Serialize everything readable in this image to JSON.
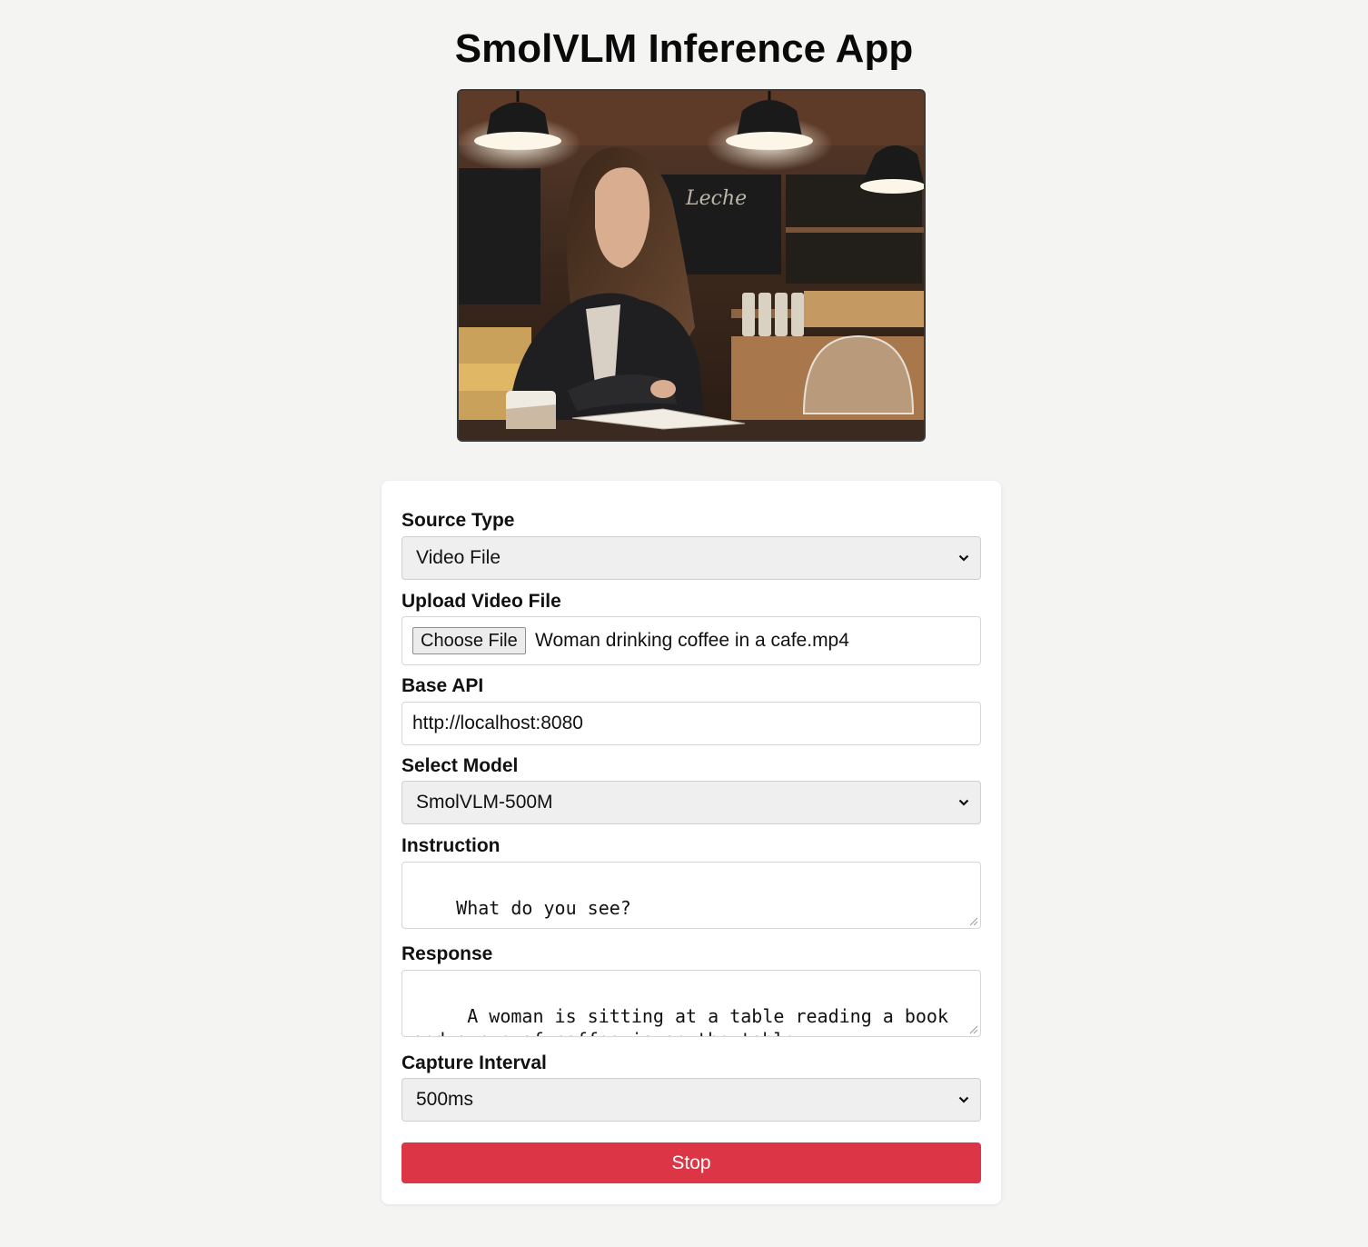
{
  "app": {
    "title": "SmolVLM Inference App"
  },
  "video": {
    "scene": "woman-reading-in-cafe"
  },
  "form": {
    "source_type": {
      "label": "Source Type",
      "selected": "Video File"
    },
    "upload": {
      "label": "Upload Video File",
      "button_label": "Choose File",
      "file_name": "Woman drinking coffee in a cafe.mp4"
    },
    "base_api": {
      "label": "Base API",
      "value": "http://localhost:8080"
    },
    "model": {
      "label": "Select Model",
      "selected": "SmolVLM-500M"
    },
    "instruction": {
      "label": "Instruction",
      "value": "What do you see?"
    },
    "response": {
      "label": "Response",
      "value": " A woman is sitting at a table reading a book and a cup of coffee is on the table."
    },
    "capture_interval": {
      "label": "Capture Interval",
      "selected": "500ms"
    },
    "action_button": {
      "label": "Stop",
      "color": "#dc3545"
    }
  },
  "icons": {
    "select_arrow": "chevron-down-icon",
    "resize_handle": "resize-grip-icon"
  }
}
